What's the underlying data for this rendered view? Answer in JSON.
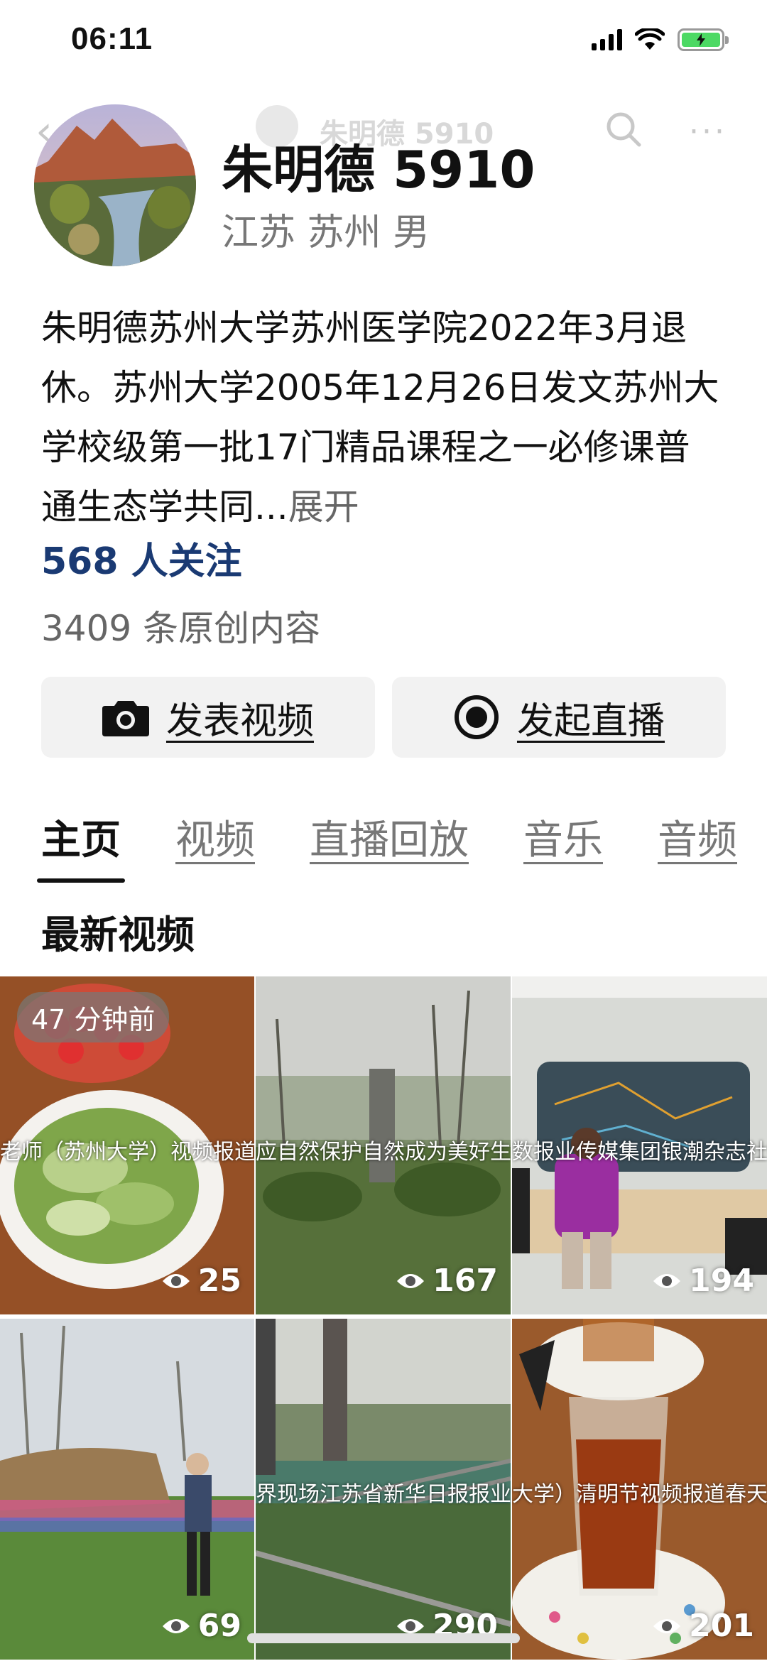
{
  "status_bar": {
    "time": "06:11"
  },
  "nav": {
    "title": "朱明德 5910"
  },
  "profile": {
    "name": "朱明德 5910",
    "location_gender": "江苏 苏州 男",
    "bio": "朱明德苏州大学苏州医学院2022年3月退休。苏州大学2005年12月26日发文苏州大学校级第一批17门精品课程之一必修课普通生态学共同...",
    "bio_expand": "展开",
    "followers": "568 人关注",
    "content_count": "3409 条原创内容"
  },
  "actions": {
    "post_video": "发表视频",
    "start_live": "发起直播"
  },
  "tabs": [
    {
      "label": "主页",
      "active": true
    },
    {
      "label": "视频",
      "active": false
    },
    {
      "label": "直播回放",
      "active": false
    },
    {
      "label": "音乐",
      "active": false
    },
    {
      "label": "音频",
      "active": false
    }
  ],
  "section_title": "最新视频",
  "videos": [
    {
      "badge": "47 分钟前",
      "caption": "老师（苏州大学）视频报道热情",
      "views": "25"
    },
    {
      "caption": "应自然保护自然成为美好生活向",
      "views": "167"
    },
    {
      "caption": "数报业传媒集团银潮杂志社银发说",
      "views": "194"
    },
    {
      "views": "69"
    },
    {
      "caption": "界现场江苏省新华日报报业传媒",
      "views": "290"
    },
    {
      "caption": "大学）清明节视频报道春天重回",
      "views": "201"
    }
  ],
  "colors": {
    "followers": "#1a3a73",
    "button_bg": "#f2f2f2",
    "battery": "#4cd964"
  }
}
